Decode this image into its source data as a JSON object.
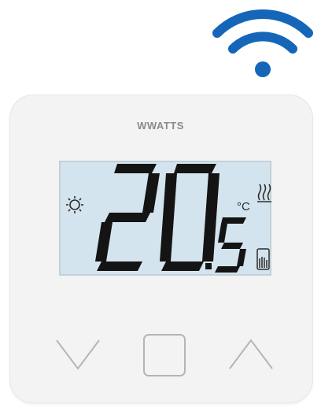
{
  "brand": {
    "name": "WWATTS"
  },
  "display": {
    "temperature": "20.5",
    "unit": "°C",
    "mode_icon": "sun-icon",
    "heating_icon": "heating-waves-icon",
    "status_icon": "hand-override-icon"
  },
  "connectivity": {
    "icon": "wifi-icon"
  },
  "buttons": {
    "down": "chevron-down-icon",
    "menu": "square-menu-icon",
    "up": "chevron-up-icon"
  },
  "colors": {
    "wifi": "#1566b8",
    "lcd_background": "#d4e4ee",
    "segment": "#141414",
    "device_body": "#f3f3f3"
  }
}
